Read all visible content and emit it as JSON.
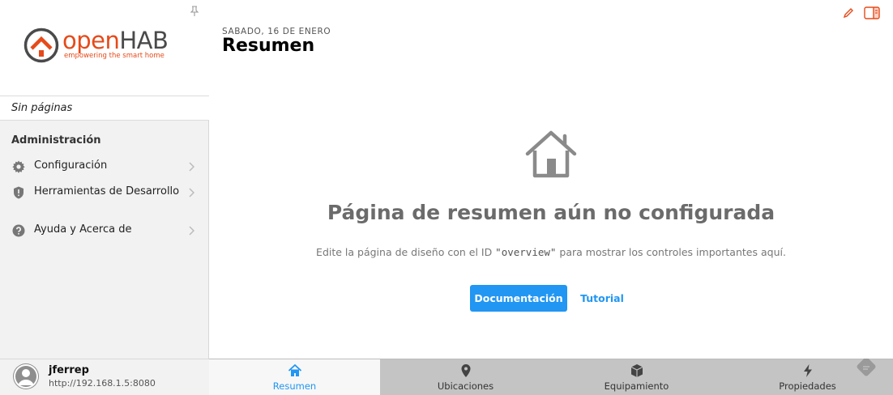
{
  "sidebar": {
    "logo": {
      "open": "open",
      "hab": "HAB",
      "tagline": "empowering the smart home"
    },
    "no_pages": "Sin páginas",
    "admin_title": "Administración",
    "items": [
      {
        "label": "Configuración",
        "icon": "gear-icon"
      },
      {
        "label": "Herramientas de Desarrollo",
        "icon": "shield-icon"
      },
      {
        "label": "Ayuda y Acerca de",
        "icon": "help-icon"
      }
    ],
    "user": {
      "name": "jferrep",
      "url": "http://192.168.1.5:8080"
    }
  },
  "header": {
    "date": "SABADO, 16 DE ENERO",
    "title": "Resumen"
  },
  "empty": {
    "title": "Página de resumen aún no configurada",
    "text_before": "Edite la página de diseño con el ID ",
    "code": "\"overview\"",
    "text_after": " para mostrar los controles importantes aquí.",
    "doc_button": "Documentación",
    "tutorial_button": "Tutorial"
  },
  "tabs": [
    {
      "label": "Resumen",
      "icon": "home-icon",
      "active": true
    },
    {
      "label": "Ubicaciones",
      "icon": "location-pin-icon",
      "active": false
    },
    {
      "label": "Equipamiento",
      "icon": "cube-icon",
      "active": false
    },
    {
      "label": "Propiedades",
      "icon": "lightning-icon",
      "active": false
    }
  ],
  "colors": {
    "brand": "#e64a19",
    "accent": "#2196f3",
    "sidebar_bg": "#f2f2f2",
    "tabbar_bg": "#c4c4c4"
  }
}
